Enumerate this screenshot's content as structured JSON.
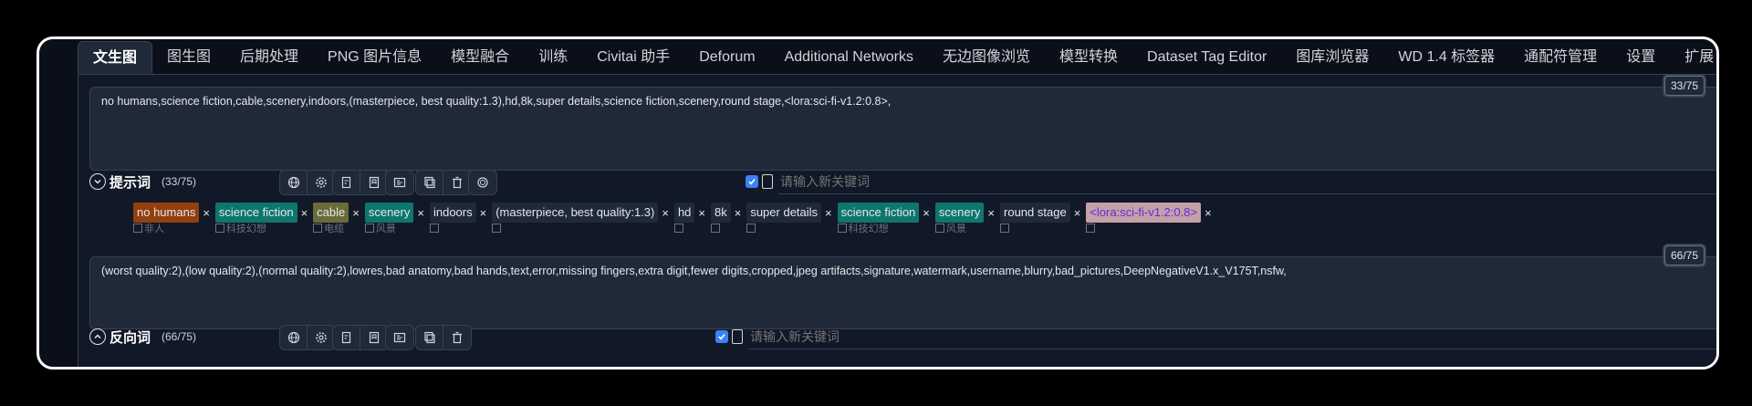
{
  "tabs": [
    {
      "label": "文生图",
      "active": true
    },
    {
      "label": "图生图"
    },
    {
      "label": "后期处理"
    },
    {
      "label": "PNG 图片信息"
    },
    {
      "label": "模型融合"
    },
    {
      "label": "训练"
    },
    {
      "label": "Civitai 助手"
    },
    {
      "label": "Deforum"
    },
    {
      "label": "Additional Networks"
    },
    {
      "label": "无边图像浏览"
    },
    {
      "label": "模型转换"
    },
    {
      "label": "Dataset Tag Editor"
    },
    {
      "label": "图库浏览器"
    },
    {
      "label": "WD 1.4 标签器"
    },
    {
      "label": "通配符管理"
    },
    {
      "label": "设置"
    },
    {
      "label": "扩展"
    }
  ],
  "positive": {
    "counter": "33/75",
    "text": "no humans,science fiction,cable,scenery,indoors,(masterpiece, best quality:1.3),hd,8k,super details,science fiction,scenery,round stage,<lora:sci-fi-v1.2:0.8>,",
    "label": "提示词",
    "count": "(33/75)",
    "keyword_placeholder": "请输入新关键词"
  },
  "tags": [
    {
      "text": "no humans",
      "sub": "非人",
      "bg": "#92400e"
    },
    {
      "text": "science fiction",
      "sub": "科技幻想",
      "bg": "#0f766e"
    },
    {
      "text": "cable",
      "sub": "电缆",
      "bg": "#6b6b3a"
    },
    {
      "text": "scenery",
      "sub": "风景",
      "bg": "#0f766e"
    },
    {
      "text": "indoors",
      "sub": "",
      "bg": ""
    },
    {
      "text": "(masterpiece, best quality:1.3)",
      "sub": "",
      "bg": ""
    },
    {
      "text": "hd",
      "sub": "",
      "bg": ""
    },
    {
      "text": "8k",
      "sub": "",
      "bg": ""
    },
    {
      "text": "super details",
      "sub": "",
      "bg": ""
    },
    {
      "text": "science fiction",
      "sub": "科技幻想",
      "bg": "#0f766e"
    },
    {
      "text": "scenery",
      "sub": "风景",
      "bg": "#0f766e"
    },
    {
      "text": "round stage",
      "sub": "",
      "bg": ""
    },
    {
      "text": "<lora:sci-fi-v1.2:0.8>",
      "sub": "",
      "bg": "#c4a0a8",
      "color": "#6d28d9"
    }
  ],
  "negative": {
    "counter": "66/75",
    "text": "(worst quality:2),(low quality:2),(normal quality:2),lowres,bad anatomy,bad hands,text,error,missing fingers,extra digit,fewer digits,cropped,jpeg artifacts,signature,watermark,username,blurry,bad_pictures,DeepNegativeV1.x_V175T,nsfw,",
    "label": "反向词",
    "count": "(66/75)",
    "keyword_placeholder": "请输入新关键词"
  },
  "toolbar_icons": [
    "globe-icon",
    "gear-icon",
    "clipboard-edit-icon",
    "bookmark-icon",
    "translate-icon",
    "copy-icon",
    "trash-icon",
    "openai-icon"
  ]
}
